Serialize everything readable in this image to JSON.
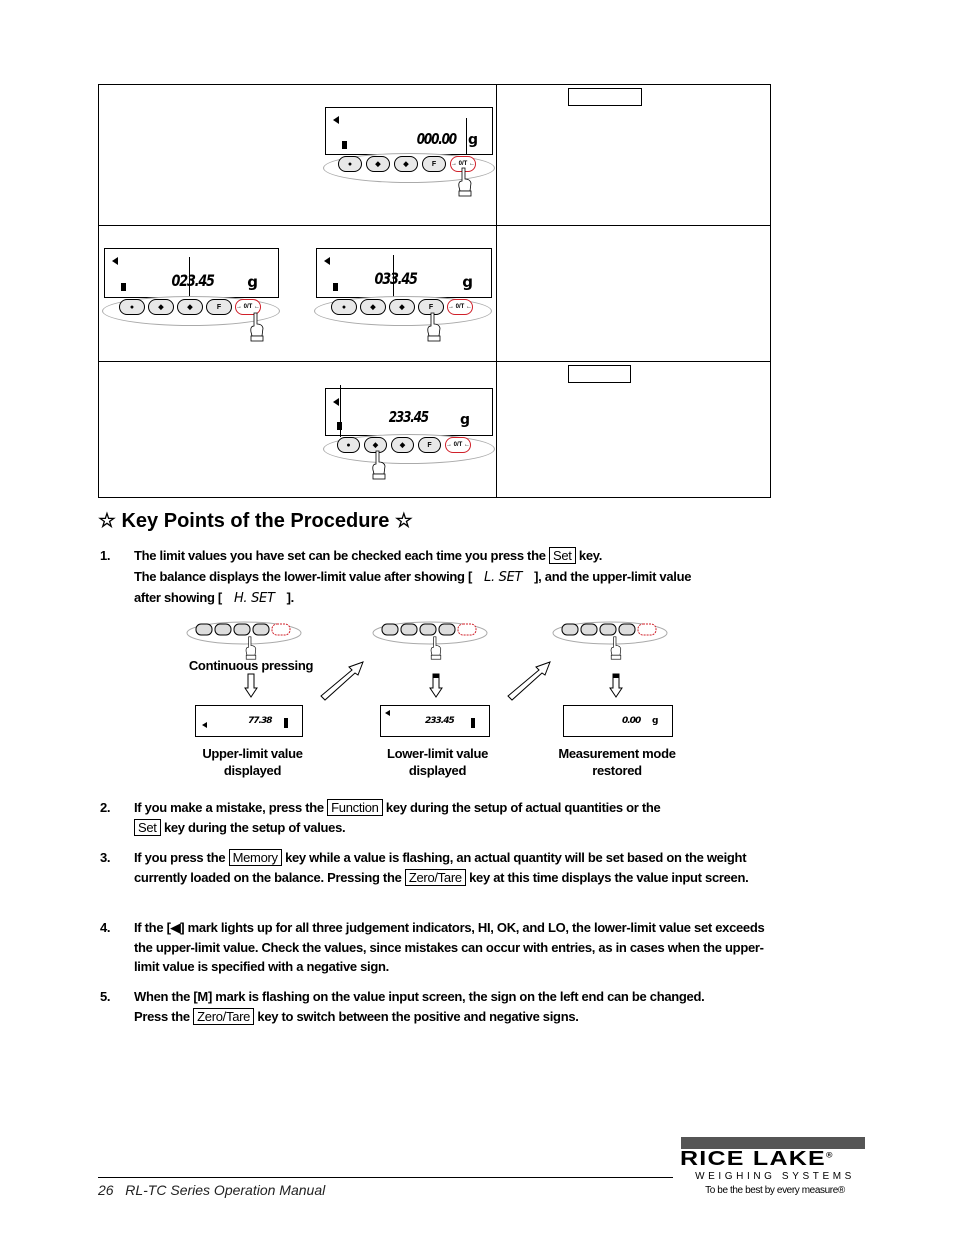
{
  "procedure_table": {
    "rows": [
      {
        "display": {
          "digits": "000.00",
          "unit": "g"
        },
        "pressed_key": "zero-tare",
        "right_key_box": ""
      },
      {
        "displays": [
          {
            "digits": "023.45",
            "unit": "g",
            "pressed_key": "zero-tare"
          },
          {
            "digits": "033.45",
            "unit": "g",
            "pressed_key": "function"
          }
        ],
        "right_key_box": null
      },
      {
        "display": {
          "digits": "233.45",
          "unit": "g"
        },
        "pressed_key": "memory",
        "right_key_box": ""
      }
    ],
    "keypad_keys": [
      {
        "symbol": "●",
        "name": "on-off"
      },
      {
        "symbol": "◆",
        "name": "memory"
      },
      {
        "symbol": "◆",
        "name": "set"
      },
      {
        "symbol": "F",
        "name": "function"
      },
      {
        "symbol": "→ 0/T ←",
        "name": "zero-tare"
      }
    ]
  },
  "key_points": {
    "heading": "☆ Key Points of the Procedure ☆",
    "items": [
      {
        "num": "1.",
        "line1_pre": "The limit values you have set can be checked each time you press the",
        "line1_key": "Set",
        "line1_post": "key.",
        "line2_pre": "The balance displays the lower-limit value after showing [",
        "line2_lcd": "L. SET",
        "line2_post": "], and the upper-limit value",
        "line3_pre": "after showing [",
        "line3_lcd": "H. SET",
        "line3_post": "]."
      },
      {
        "num": "2.",
        "pre": "If you make a mistake, press the",
        "key1": "Function",
        "mid": "key during the setup of actual quantities or the",
        "key2": "Set",
        "post": "key during the setup of values."
      },
      {
        "num": "3.",
        "pre": "If you press the",
        "key1": "Memory",
        "mid": "key while a value is flashing, an actual quantity will be set based on the weight currently loaded on the balance.  Pressing the",
        "key2": "Zero/Tare",
        "post": "key at this time displays the value input screen."
      },
      {
        "num": "4.",
        "text": "If the [◀] mark lights up for all three judgement indicators, HI, OK, and LO, the lower-limit value set exceeds the upper-limit value.  Check the values, since mistakes can occur with entries, as in cases when the upper-limit value is specified with a negative sign."
      },
      {
        "num": "5.",
        "line1": "When the [M] mark is flashing on the value input screen, the sign on the left end can be changed.",
        "pre": "Press the",
        "key1": "Zero/Tare",
        "post": "key to switch between the positive and negative signs."
      }
    ]
  },
  "flow_diagram": {
    "press_label": "Continuous pressing",
    "steps": [
      {
        "display": "77.38",
        "caption_l1": "Upper-limit value",
        "caption_l2": "displayed"
      },
      {
        "display": "233.45",
        "caption_l1": "Lower-limit value",
        "caption_l2": "displayed"
      },
      {
        "display": "0.00",
        "unit": "g",
        "caption_l1": "Measurement mode",
        "caption_l2": "restored"
      }
    ]
  },
  "footer": {
    "page_label": "26   RL-TC Series Operation Manual",
    "logo_name": "RICE LAKE",
    "logo_registered": "®",
    "logo_sub": "WEIGHING SYSTEMS",
    "logo_tagline": "To be the best by every measure®"
  }
}
